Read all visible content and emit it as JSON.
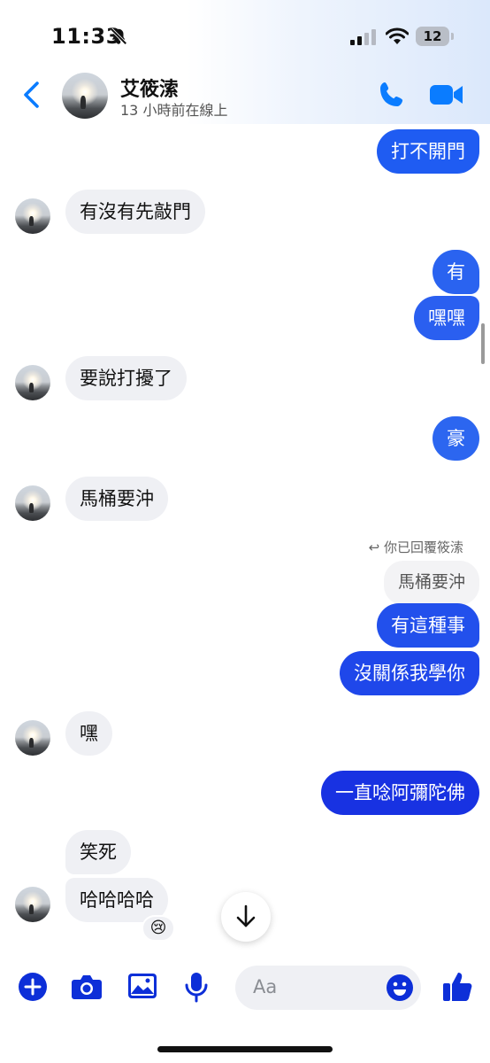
{
  "status_bar": {
    "time": "11:33",
    "battery": "12"
  },
  "header": {
    "contact_name": "艾筱溹",
    "contact_status": "13 小時前在線上",
    "icons": [
      "back-chevron-icon",
      "phone-icon",
      "video-camera-icon"
    ]
  },
  "messages": [
    {
      "side": "out",
      "text": "打不開門"
    },
    {
      "side": "in",
      "text": "有沒有先敲門"
    },
    {
      "side": "out",
      "text": "有"
    },
    {
      "side": "out",
      "text": "嘿嘿"
    },
    {
      "side": "in",
      "text": "要說打擾了"
    },
    {
      "side": "out",
      "text": "豪"
    },
    {
      "side": "in",
      "text": "馬桶要沖"
    },
    {
      "side": "out",
      "text": "有這種事"
    },
    {
      "side": "out",
      "text": "沒關係我學你"
    },
    {
      "side": "in",
      "text": "嘿"
    },
    {
      "side": "out",
      "text": "一直唸阿彌陀佛"
    },
    {
      "side": "in",
      "text": "笑死"
    },
    {
      "side": "in",
      "text": "哈哈哈哈"
    }
  ],
  "reply": {
    "note": "你已回覆筱溹",
    "quoted": "馬桶要沖"
  },
  "reaction": {
    "emoji": "😢"
  },
  "composer": {
    "placeholder": "Aa",
    "icons": [
      "plus-icon",
      "camera-icon",
      "image-icon",
      "microphone-icon",
      "emoji-icon",
      "thumbs-up-icon"
    ]
  },
  "colors": {
    "accent": "#0a7cff",
    "bubble_out_top": "#2f6cf0",
    "bubble_out_bottom": "#1a2fe0",
    "bubble_in": "#eff0f4"
  }
}
